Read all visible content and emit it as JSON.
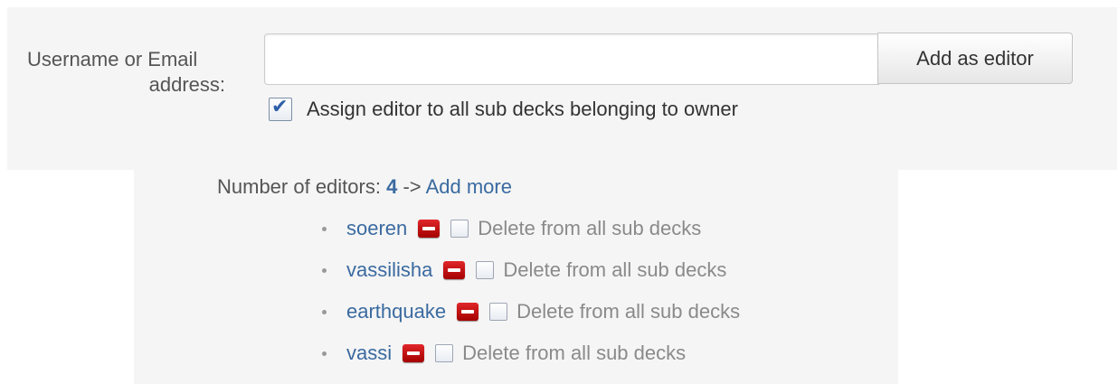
{
  "form": {
    "label_line1": "Username or Email",
    "label_line2": "address:",
    "input_value": "",
    "input_placeholder": "",
    "add_button_label": "Add as editor",
    "assign_checked": true,
    "assign_label": "Assign editor to all sub decks belonging to owner"
  },
  "editors": {
    "count_prefix": "Number of editors:",
    "count": "4",
    "arrow": "->",
    "add_more_label": "Add more",
    "items": [
      {
        "name": "soeren",
        "delete_label": "Delete from all sub decks",
        "checked": false
      },
      {
        "name": "vassilisha",
        "delete_label": "Delete from all sub decks",
        "checked": false
      },
      {
        "name": "earthquake",
        "delete_label": "Delete from all sub decks",
        "checked": false
      },
      {
        "name": "vassi",
        "delete_label": "Delete from all sub decks",
        "checked": false
      }
    ]
  },
  "icons": {
    "remove": "remove-icon",
    "checkbox_checked": "checkbox-checked-icon",
    "checkbox_empty": "checkbox-empty-icon"
  },
  "colors": {
    "link": "#3a6aa0",
    "remove_icon": "#c4161c",
    "panel_bg": "#f5f5f5"
  }
}
